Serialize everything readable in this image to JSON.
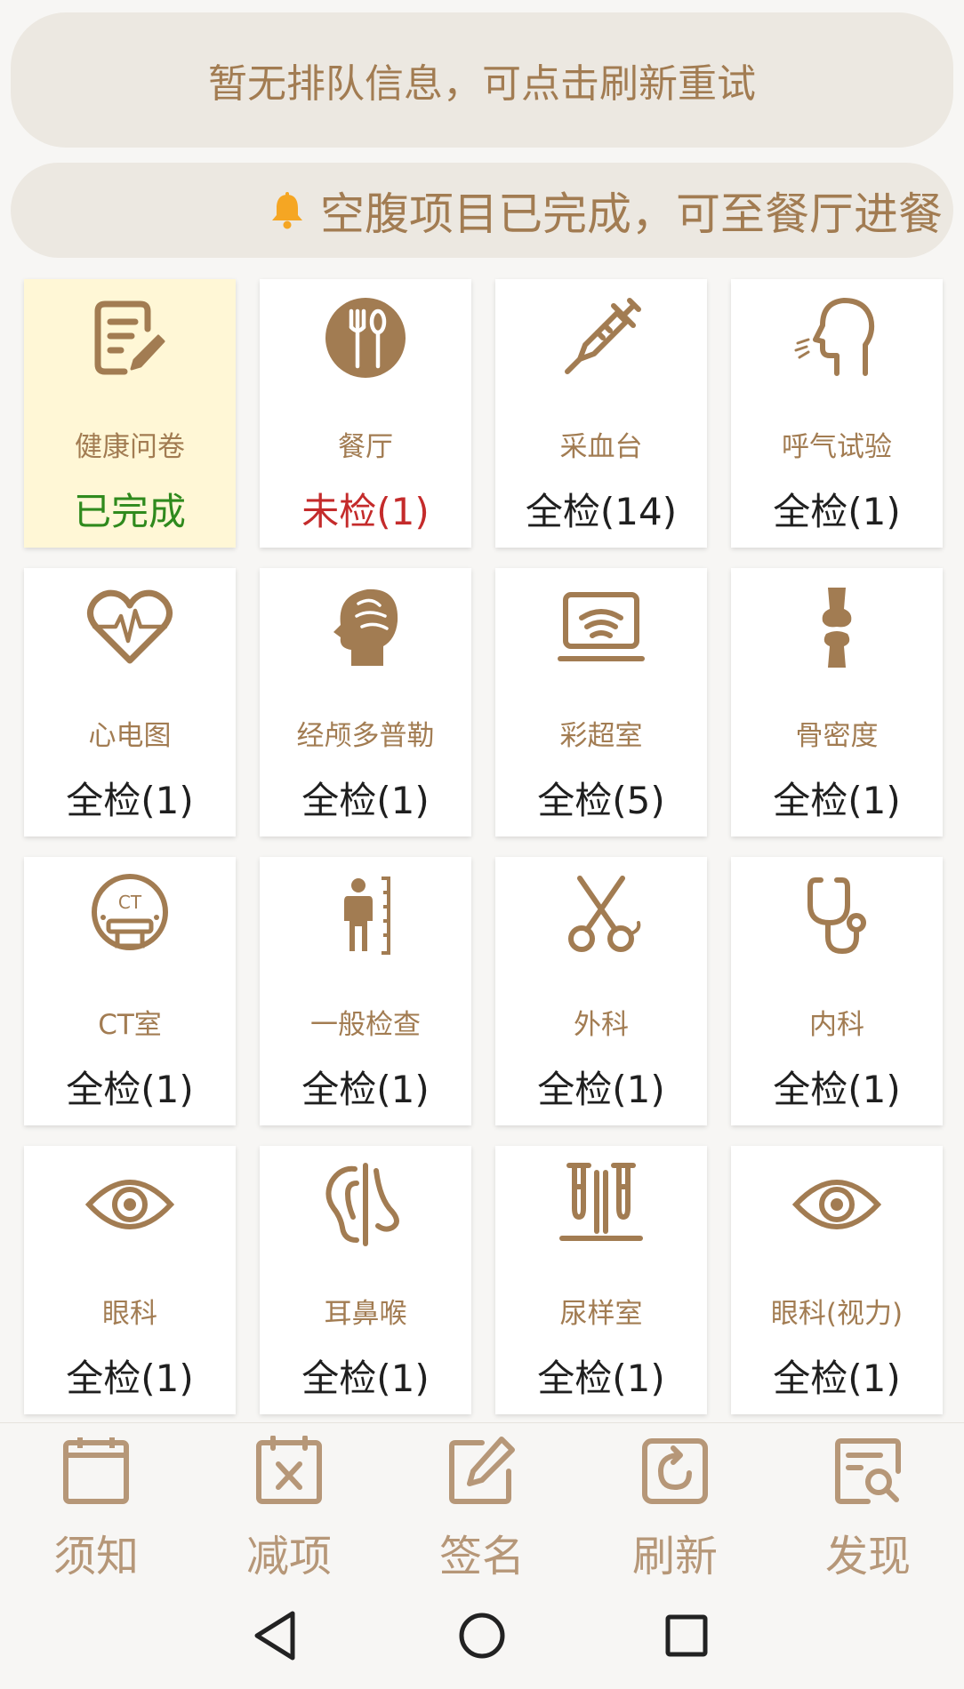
{
  "queue_banner": {
    "text": "暂无排队信息，可点击刷新重试"
  },
  "notice_banner": {
    "text": "空腹项目已完成，可至餐厅进餐",
    "icon": "bell-icon"
  },
  "colors": {
    "accent": "#a27c52",
    "banner_bg": "#ece8e1",
    "done_bg": "#fff7d6",
    "status_done": "#2f8a1d",
    "status_pending": "#c42b2b",
    "nav_label": "#b69778"
  },
  "tiles": [
    {
      "name": "健康问卷",
      "status": "已完成",
      "icon": "questionnaire-icon"
    },
    {
      "name": "餐厅",
      "status": "未检(1)",
      "icon": "fork-spoon-icon"
    },
    {
      "name": "采血台",
      "status": "全检(14)",
      "icon": "syringe-icon"
    },
    {
      "name": "呼气试验",
      "status": "全检(1)",
      "icon": "breath-test-icon"
    },
    {
      "name": "心电图",
      "status": "全检(1)",
      "icon": "heart-ecg-icon"
    },
    {
      "name": "经颅多普勒",
      "status": "全检(1)",
      "icon": "head-brain-icon"
    },
    {
      "name": "彩超室",
      "status": "全检(5)",
      "icon": "ultrasound-icon"
    },
    {
      "name": "骨密度",
      "status": "全检(1)",
      "icon": "bone-icon"
    },
    {
      "name": "CT室",
      "status": "全检(1)",
      "icon": "ct-scanner-icon",
      "icon_label": "CT"
    },
    {
      "name": "一般检查",
      "status": "全检(1)",
      "icon": "height-measure-icon"
    },
    {
      "name": "外科",
      "status": "全检(1)",
      "icon": "scissors-icon"
    },
    {
      "name": "内科",
      "status": "全检(1)",
      "icon": "stethoscope-icon"
    },
    {
      "name": "眼科",
      "status": "全检(1)",
      "icon": "eye-icon"
    },
    {
      "name": "耳鼻喉",
      "status": "全检(1)",
      "icon": "ear-nose-icon"
    },
    {
      "name": "尿样室",
      "status": "全检(1)",
      "icon": "test-tubes-icon"
    },
    {
      "name": "眼科(视力)",
      "status": "全检(1)",
      "icon": "eye-icon"
    }
  ],
  "bottom_nav": [
    {
      "label": "须知",
      "icon": "notice-icon"
    },
    {
      "label": "减项",
      "icon": "remove-item-icon"
    },
    {
      "label": "签名",
      "icon": "signature-icon"
    },
    {
      "label": "刷新",
      "icon": "refresh-icon"
    },
    {
      "label": "发现",
      "icon": "discover-icon"
    }
  ],
  "system_nav": [
    {
      "icon": "back-triangle-icon"
    },
    {
      "icon": "home-circle-icon"
    },
    {
      "icon": "recents-square-icon"
    }
  ]
}
